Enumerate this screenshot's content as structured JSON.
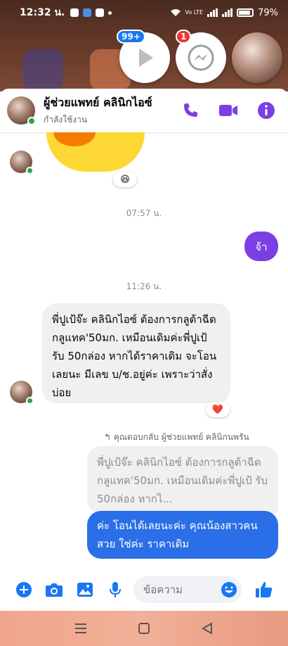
{
  "status_bar": {
    "time": "12:32 น.",
    "battery": "79%",
    "carrier": "Vo LTE"
  },
  "chat_heads": [
    {
      "badge": "99+",
      "name": "youtube-chathead"
    },
    {
      "badge": "1",
      "name": "messenger-chathead"
    },
    {
      "badge": "",
      "name": "profile-chathead"
    }
  ],
  "header": {
    "name": "ผู้ช่วยแพทย์ คลินิกไอซ์",
    "status": "กำลังใช้งาน"
  },
  "messages": {
    "sticker_reaction": "😆",
    "timestamp_1": "07:57 น.",
    "outgoing_1": "จ้า",
    "timestamp_2": "11:26 น.",
    "incoming_1": "พี่ปูเป้จ๊ะ คลินิกไอซ์ ต้องการกลูต้าฉีด กลูแทค'50มก.  เหมือนเดิมค่ะพี่ปูเป้ รับ 50กล่อง หากได้ราคาเดิม จะโอนเลยนะ มีเลข บ/ช.อยู่ค่ะ เพราะว่าสั่งบ่อย",
    "incoming_reaction": "❤️",
    "reply_label": "คุณตอบกลับ ผู้ช่วยแพทย์ คลินิกนพรัน",
    "quoted_text": "พี่ปูเป้จ๊ะ คลินิกไอซ์ ต้องการกลูต้าฉีด กลูแทค'50มก.  เหมือนเดิมค่ะพี่ปูเป้ รับ 50กล่อง หากไ...",
    "reply_text": "ค่ะ โอนได้เลยนะค่ะ คุณน้องสาวคนสวย ใช่ค่ะ ราคาเดิม"
  },
  "composer": {
    "placeholder": "ข้อความ"
  },
  "colors": {
    "accent_purple": "#7b3fe4",
    "reply_blue": "#2a6fe8",
    "messenger_blue": "#1877f2",
    "online_green": "#31a24c"
  },
  "icons": [
    "plus-icon",
    "camera-icon",
    "gallery-icon",
    "mic-icon",
    "emoji-icon",
    "like-icon",
    "phone-icon",
    "video-icon",
    "info-icon"
  ]
}
